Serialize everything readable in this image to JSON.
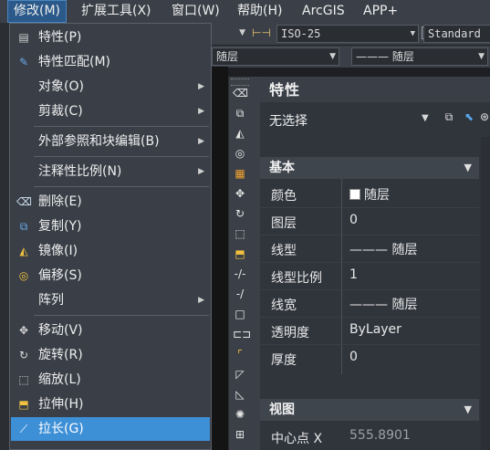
{
  "menubar": {
    "items": [
      "修改(M)",
      "扩展工具(X)",
      "窗口(W)",
      "帮助(H)",
      "ArcGIS",
      "APP+"
    ]
  },
  "toolbar": {
    "dimstyle": "ISO-25",
    "textstyle": "Standard",
    "layer_value": "随层",
    "linetype_value": "——— 随层"
  },
  "menu": {
    "items": [
      {
        "label": "特性(P)",
        "icon": "properties-icon"
      },
      {
        "label": "特性匹配(M)",
        "icon": "match-brush-icon"
      },
      {
        "label": "对象(O)",
        "submenu": true
      },
      {
        "label": "剪裁(C)",
        "submenu": true
      },
      {
        "label": "外部参照和块编辑(B)",
        "submenu": true
      },
      {
        "label": "注释性比例(N)",
        "submenu": true
      },
      {
        "label": "删除(E)",
        "icon": "eraser-icon"
      },
      {
        "label": "复制(Y)",
        "icon": "copy-icon"
      },
      {
        "label": "镜像(I)",
        "icon": "mirror-icon"
      },
      {
        "label": "偏移(S)",
        "icon": "offset-icon"
      },
      {
        "label": "阵列",
        "submenu": true
      },
      {
        "label": "移动(V)",
        "icon": "move-icon"
      },
      {
        "label": "旋转(R)",
        "icon": "rotate-icon"
      },
      {
        "label": "缩放(L)",
        "icon": "scale-icon"
      },
      {
        "label": "拉伸(H)",
        "icon": "stretch-icon"
      },
      {
        "label": "拉长(G)",
        "icon": "lengthen-icon",
        "highlighted": true
      }
    ]
  },
  "properties": {
    "title": "特性",
    "selection": "无选择",
    "sections": {
      "basic": "基本",
      "view": "视图"
    },
    "rows": [
      {
        "name": "颜色",
        "value": "随层"
      },
      {
        "name": "图层",
        "value": "0"
      },
      {
        "name": "线型",
        "value": "——— 随层"
      },
      {
        "name": "线型比例",
        "value": "1"
      },
      {
        "name": "线宽",
        "value": "——— 随层"
      },
      {
        "name": "透明度",
        "value": "ByLayer"
      },
      {
        "name": "厚度",
        "value": "0"
      }
    ],
    "view_rows": [
      {
        "name": "中心点 X",
        "value": "555.8901"
      }
    ]
  },
  "colors": {
    "menubar": "#3b4048",
    "highlight": "#3d8fd6",
    "panel": "#30353c"
  }
}
